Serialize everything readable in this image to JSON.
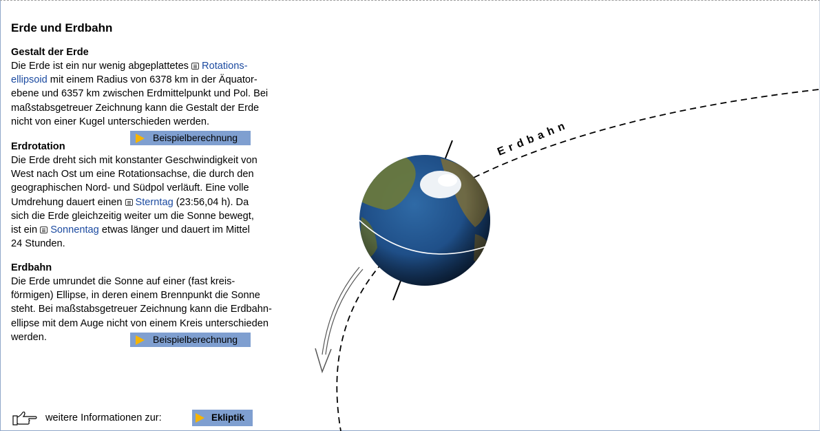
{
  "title": "Erde und Erdbahn",
  "gestalt": {
    "heading": "Gestalt der Erde",
    "t1": "Die Erde ist ein nur wenig abgeplattetes ",
    "link1a": "Rotations-",
    "link1b": "ellipsoid",
    "t2": " mit einem Radius von 6378 km in der Äquator-",
    "t3": "ebene und 6357 km zwischen Erdmittelpunkt und Pol. Bei",
    "t4": "maßstabsgetreuer Zeichnung kann die Gestalt der Erde",
    "t5": "nicht von einer Kugel unterschieden werden.",
    "button": "Beispielberechnung"
  },
  "rotation": {
    "heading": "Erdrotation",
    "t1": "Die Erde dreht sich mit konstanter Geschwindigkeit von",
    "t2": "West nach Ost um eine Rotationsachse, die durch den",
    "t3": "geographischen Nord- und Südpol verläuft. Eine volle",
    "t4a": "Umdrehung dauert einen ",
    "link_stern": "Sterntag",
    "t4b": " (23:56,04 h). Da",
    "t5": "sich die Erde gleichzeitig weiter um die Sonne bewegt,",
    "t6a": "ist ein ",
    "link_sonne": "Sonnentag",
    "t6b": " etwas  länger und dauert im Mittel",
    "t7": "24 Stunden."
  },
  "bahn": {
    "heading": "Erdbahn",
    "t1": "Die Erde umrundet die Sonne auf einer (fast kreis-",
    "t2": "förmigen) Ellipse, in deren einem Brennpunkt die Sonne",
    "t3": "steht. Bei maßstabsgetreuer Zeichnung kann die Erdbahn-",
    "t4": "ellipse mit dem Auge nicht von einem Kreis unterschieden",
    "t5": "werden.",
    "button": "Beispielberechnung"
  },
  "orbit_label": "Erdbahn",
  "more": {
    "label": "weitere Informationen zur:",
    "button": "Ekliptik"
  },
  "colors": {
    "link": "#1b4aa0",
    "button_bg": "#7f9fd0",
    "play": "#f6b400",
    "ocean": "#1f4f88",
    "land": "#6d7a3a"
  }
}
